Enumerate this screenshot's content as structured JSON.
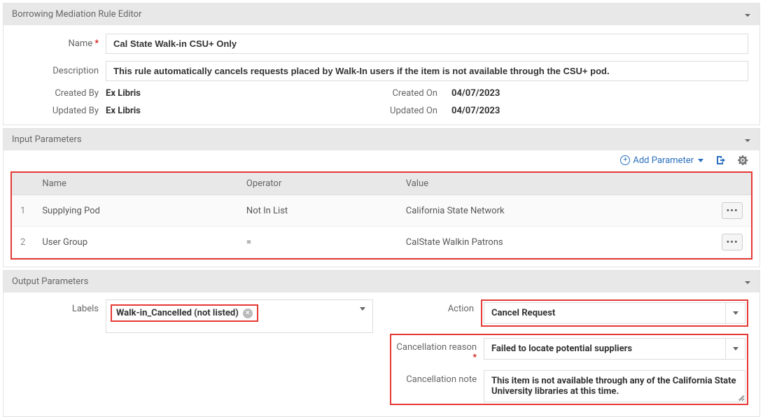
{
  "editor": {
    "panel_title": "Borrowing Mediation Rule Editor",
    "fields": {
      "name_label": "Name",
      "name_value": "Cal State Walk-in CSU+ Only",
      "description_label": "Description",
      "description_value": "This rule automatically cancels requests placed by Walk-In users if the item is not available through the CSU+ pod.",
      "created_by_label": "Created By",
      "created_by_value": "Ex Libris",
      "created_on_label": "Created On",
      "created_on_value": "04/07/2023",
      "updated_by_label": "Updated By",
      "updated_by_value": "Ex Libris",
      "updated_on_label": "Updated On",
      "updated_on_value": "04/07/2023"
    }
  },
  "input_params": {
    "panel_title": "Input Parameters",
    "add_parameter_label": "Add Parameter",
    "columns": {
      "name": "Name",
      "operator": "Operator",
      "value": "Value"
    },
    "rows": [
      {
        "idx": "1",
        "name": "Supplying Pod",
        "operator": "Not In List",
        "value": "California State Network"
      },
      {
        "idx": "2",
        "name": "User Group",
        "operator": "=",
        "value": "CalState Walkin Patrons"
      }
    ]
  },
  "output_params": {
    "panel_title": "Output Parameters",
    "labels_label": "Labels",
    "labels_chip": "Walk-in_Cancelled (not listed)",
    "action_label": "Action",
    "action_value": "Cancel Request",
    "cancel_reason_label": "Cancellation reason",
    "cancel_reason_value": "Failed to locate potential suppliers",
    "cancel_note_label": "Cancellation note",
    "cancel_note_value": "This item is not available through any of the California State University libraries at this time."
  }
}
